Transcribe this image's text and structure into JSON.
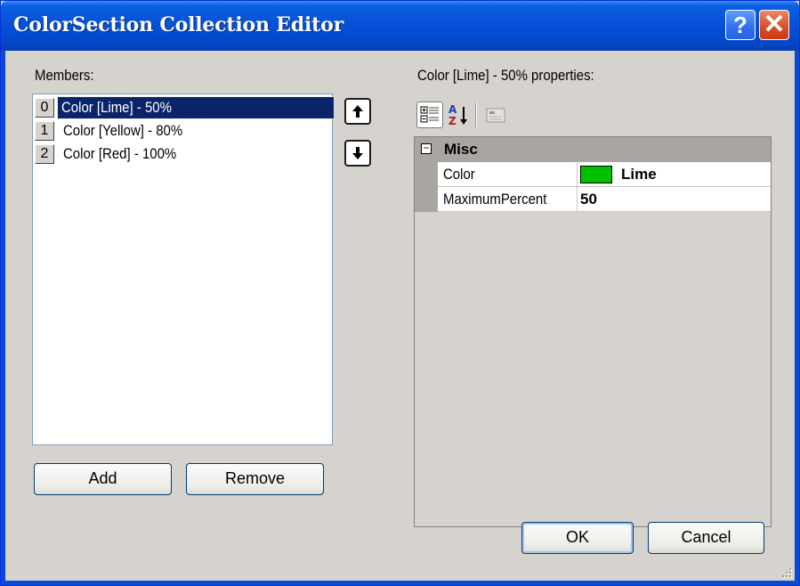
{
  "window": {
    "title": "ColorSection Collection Editor",
    "help_glyph": "?",
    "close_glyph": "✕"
  },
  "members": {
    "label": "Members:",
    "items": [
      {
        "index": "0",
        "label": "Color [Lime] - 50%",
        "selected": true
      },
      {
        "index": "1",
        "label": "Color [Yellow] - 80%",
        "selected": false
      },
      {
        "index": "2",
        "label": "Color [Red] - 100%",
        "selected": false
      }
    ],
    "move_up_icon": "arrow-up-icon",
    "move_down_icon": "arrow-down-icon",
    "add_label": "Add",
    "remove_label": "Remove"
  },
  "properties": {
    "label": "Color [Lime] - 50% properties:",
    "toolbar": {
      "categorized_icon": "categorized-icon",
      "alphabetical_icon": "alphabetical-sort-icon",
      "property_pages_icon": "property-pages-icon"
    },
    "category": {
      "toggle": "⊟",
      "name": "Misc"
    },
    "rows": [
      {
        "name": "Color",
        "value": "Lime",
        "swatch_color": "#00c000"
      },
      {
        "name": "MaximumPercent",
        "value": "50"
      }
    ]
  },
  "footer": {
    "ok_label": "OK",
    "cancel_label": "Cancel"
  },
  "colors": {
    "titlebar": "#0551d8",
    "selection": "#0a246a",
    "dialog_bg": "#d6d3ce"
  }
}
